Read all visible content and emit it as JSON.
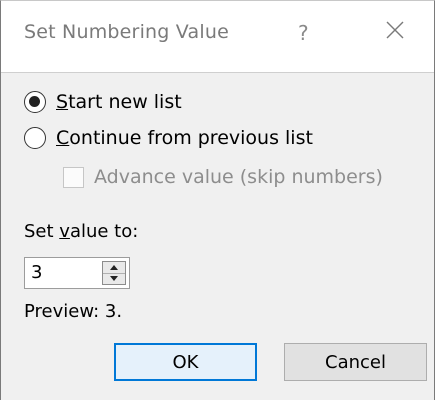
{
  "dialog": {
    "title": "Set Numbering Value",
    "help_glyph": "?"
  },
  "options": {
    "start_new_list": {
      "prefix": "",
      "accel": "S",
      "rest": "tart new list",
      "checked": true
    },
    "continue_previous": {
      "prefix": "",
      "accel": "C",
      "rest": "ontinue from previous list",
      "checked": false
    },
    "advance_value": {
      "label": "Advance value (skip numbers)",
      "checked": false,
      "enabled": false
    }
  },
  "set_value": {
    "label_prefix": "Set ",
    "label_accel": "v",
    "label_rest": "alue to:",
    "value": "3"
  },
  "preview": {
    "text": "Preview: 3."
  },
  "buttons": {
    "ok": "OK",
    "cancel": "Cancel"
  },
  "colors": {
    "accent": "#0078d7",
    "client_bg": "#f0f0f0"
  }
}
